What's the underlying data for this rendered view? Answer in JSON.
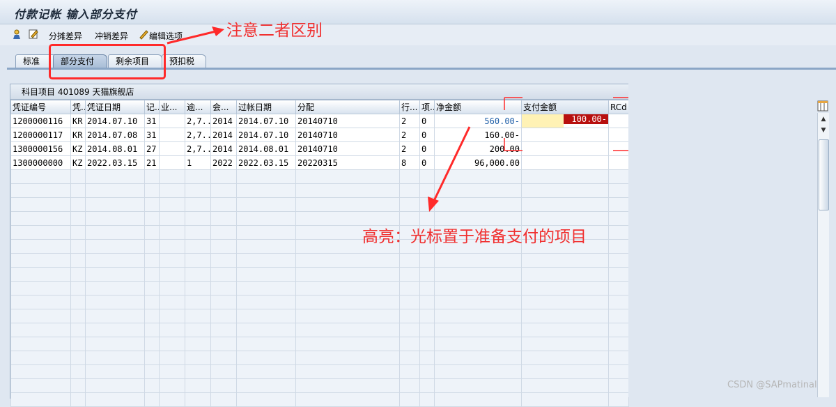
{
  "window": {
    "title": "付款记帐 输入部分支付"
  },
  "toolbar": {
    "items": [
      "分摊差异",
      "冲销差异",
      "编辑选项"
    ]
  },
  "tabs": [
    "标准",
    "部分支付",
    "剩余项目",
    "预扣税"
  ],
  "annotations": {
    "note1": "注意二者区别",
    "note2": "高亮：光标置于准备支付的项目"
  },
  "panel": {
    "title": "科目项目 401089 天猫旗舰店"
  },
  "columns": [
    "凭证编号",
    "凭..",
    "凭证日期",
    "记..",
    "业...",
    "逾...",
    "会...",
    "过帐日期",
    "分配",
    "行...",
    "项..",
    "净金额",
    "支付金额",
    "RCd"
  ],
  "rows": [
    [
      "1200000116",
      "KR",
      "2014.07.10",
      "31",
      "",
      "2,7..",
      "2014",
      "2014.07.10",
      "20140710",
      "2",
      "0",
      "560.00-",
      "100.00-",
      ""
    ],
    [
      "1200000117",
      "KR",
      "2014.07.08",
      "31",
      "",
      "2,7..",
      "2014",
      "2014.07.10",
      "20140710",
      "2",
      "0",
      "160.00-",
      "",
      ""
    ],
    [
      "1300000156",
      "KZ",
      "2014.08.01",
      "27",
      "",
      "2,7..",
      "2014",
      "2014.08.01",
      "20140710",
      "2",
      "0",
      "200.00",
      "",
      ""
    ],
    [
      "1300000000",
      "KZ",
      "2022.03.15",
      "21",
      "",
      "1",
      "2022",
      "2022.03.15",
      "20220315",
      "8",
      "0",
      "96,000.00",
      "",
      ""
    ]
  ],
  "watermark": "CSDN @SAPmatinal",
  "colors": {
    "annotation": "#ff2a2a",
    "highlight_value": "#b8100f",
    "input_fill": "#fff2b5"
  }
}
